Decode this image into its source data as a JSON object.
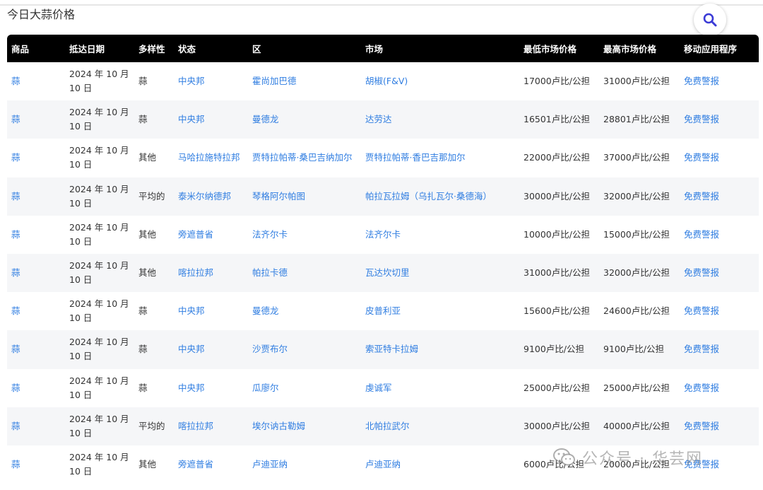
{
  "page_title": "今日大蒜价格",
  "icons": {
    "search": "search-icon",
    "watermark": "wechat-icon"
  },
  "colors": {
    "link": "#2f7de1",
    "header_bg": "#000000",
    "row_alt": "#f5f6f8"
  },
  "table": {
    "headers": [
      "商品",
      "抵达日期",
      "多样性",
      "状态",
      "区",
      "市场",
      "最低市场价格",
      "最高市场价格",
      "移动应用程序"
    ],
    "rows": [
      {
        "commodity": "蒜",
        "date": "2024 年 10 月 10 日",
        "variety": "蒜",
        "state": "中央邦",
        "district": "霍尚加巴德",
        "market": "胡椒(F&V)",
        "min": "17000卢比/公担",
        "max": "31000卢比/公担",
        "app": "免费警报"
      },
      {
        "commodity": "蒜",
        "date": "2024 年 10 月 10 日",
        "variety": "蒜",
        "state": "中央邦",
        "district": "曼德龙",
        "market": "达劳达",
        "min": "16501卢比/公担",
        "max": "28801卢比/公担",
        "app": "免费警报"
      },
      {
        "commodity": "蒜",
        "date": "2024 年 10 月 10 日",
        "variety": "其他",
        "state": "马哈拉施特拉邦",
        "district": "贾特拉帕蒂·桑巴吉纳加尔",
        "market": "贾特拉帕蒂·香巴吉那加尔",
        "min": "22000卢比/公担",
        "max": "37000卢比/公担",
        "app": "免费警报"
      },
      {
        "commodity": "蒜",
        "date": "2024 年 10 月 10 日",
        "variety": "平均的",
        "state": "泰米尔纳德邦",
        "district": "琴格阿尔帕图",
        "market": "帕拉瓦拉姆（乌扎瓦尔·桑德海）",
        "min": "30000卢比/公担",
        "max": "32000卢比/公担",
        "app": "免费警报"
      },
      {
        "commodity": "蒜",
        "date": "2024 年 10 月 10 日",
        "variety": "其他",
        "state": "旁遮普省",
        "district": "法齐尔卡",
        "market": "法齐尔卡",
        "min": "10000卢比/公担",
        "max": "15000卢比/公担",
        "app": "免费警报"
      },
      {
        "commodity": "蒜",
        "date": "2024 年 10 月 10 日",
        "variety": "其他",
        "state": "喀拉拉邦",
        "district": "帕拉卡德",
        "market": "瓦达坎切里",
        "min": "31000卢比/公担",
        "max": "32000卢比/公担",
        "app": "免费警报"
      },
      {
        "commodity": "蒜",
        "date": "2024 年 10 月 10 日",
        "variety": "蒜",
        "state": "中央邦",
        "district": "曼德龙",
        "market": "皮普利亚",
        "min": "15600卢比/公担",
        "max": "24600卢比/公担",
        "app": "免费警报"
      },
      {
        "commodity": "蒜",
        "date": "2024 年 10 月 10 日",
        "variety": "蒜",
        "state": "中央邦",
        "district": "沙贾布尔",
        "market": "索亚特卡拉姆",
        "min": "9100卢比/公担",
        "max": "9100卢比/公担",
        "app": "免费警报"
      },
      {
        "commodity": "蒜",
        "date": "2024 年 10 月 10 日",
        "variety": "蒜",
        "state": "中央邦",
        "district": "瓜廖尔",
        "market": "虔诚军",
        "min": "25000卢比/公担",
        "max": "25000卢比/公担",
        "app": "免费警报"
      },
      {
        "commodity": "蒜",
        "date": "2024 年 10 月 10 日",
        "variety": "平均的",
        "state": "喀拉拉邦",
        "district": "埃尔讷古勒姆",
        "market": "北帕拉武尔",
        "min": "30000卢比/公担",
        "max": "40000卢比/公担",
        "app": "免费警报"
      },
      {
        "commodity": "蒜",
        "date": "2024 年 10 月 10 日",
        "variety": "其他",
        "state": "旁遮普省",
        "district": "卢迪亚纳",
        "market": "卢迪亚纳",
        "min": "6000卢比/公担",
        "max": "20000卢比/公担",
        "app": "免费警报"
      }
    ]
  },
  "watermark_text": "公众号 · 华芸网"
}
